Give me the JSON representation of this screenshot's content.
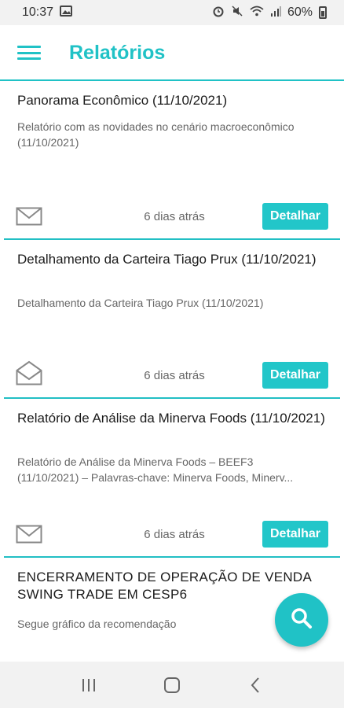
{
  "status_bar": {
    "time": "10:37",
    "battery": "60%",
    "icons": [
      "image-icon",
      "alarm-icon",
      "mute-icon",
      "wifi-icon",
      "signal-icon",
      "battery-icon"
    ]
  },
  "header": {
    "title": "Relatórios",
    "menu_icon": "hamburger-menu-icon"
  },
  "reports": [
    {
      "title": "Panorama Econômico (11/10/2021)",
      "description": "Relatório com as novidades no cenário macroeconômico (11/10/2021)",
      "time_ago": "6 dias atrás",
      "read": false,
      "button_label": "Detalhar"
    },
    {
      "title": "Detalhamento da Carteira Tiago Prux (11/10/2021)",
      "description": "Detalhamento da Carteira Tiago Prux (11/10/2021)",
      "time_ago": "6 dias atrás",
      "read": true,
      "button_label": "Detalhar"
    },
    {
      "title": "Relatório de Análise da Minerva Foods (11/10/2021)",
      "description_line1": "Relatório de Análise da Minerva Foods – BEEF3",
      "description_line2": "(11/10/2021) – Palavras-chave: Minerva Foods, Minerv...",
      "time_ago": "6 dias atrás",
      "read": false,
      "button_label": "Detalhar"
    },
    {
      "title": "ENCERRAMENTO DE OPERAÇÃO DE VENDA SWING TRADE EM CESP6",
      "description": "Segue gráfico da recomendação"
    }
  ],
  "fab": {
    "icon": "search-icon"
  },
  "nav_bar": {
    "icons": [
      "recent-apps-icon",
      "home-icon",
      "back-icon"
    ]
  },
  "colors": {
    "accent": "#20c2c6",
    "divider": "#22bfc4",
    "bars": "#f2f2f2"
  }
}
